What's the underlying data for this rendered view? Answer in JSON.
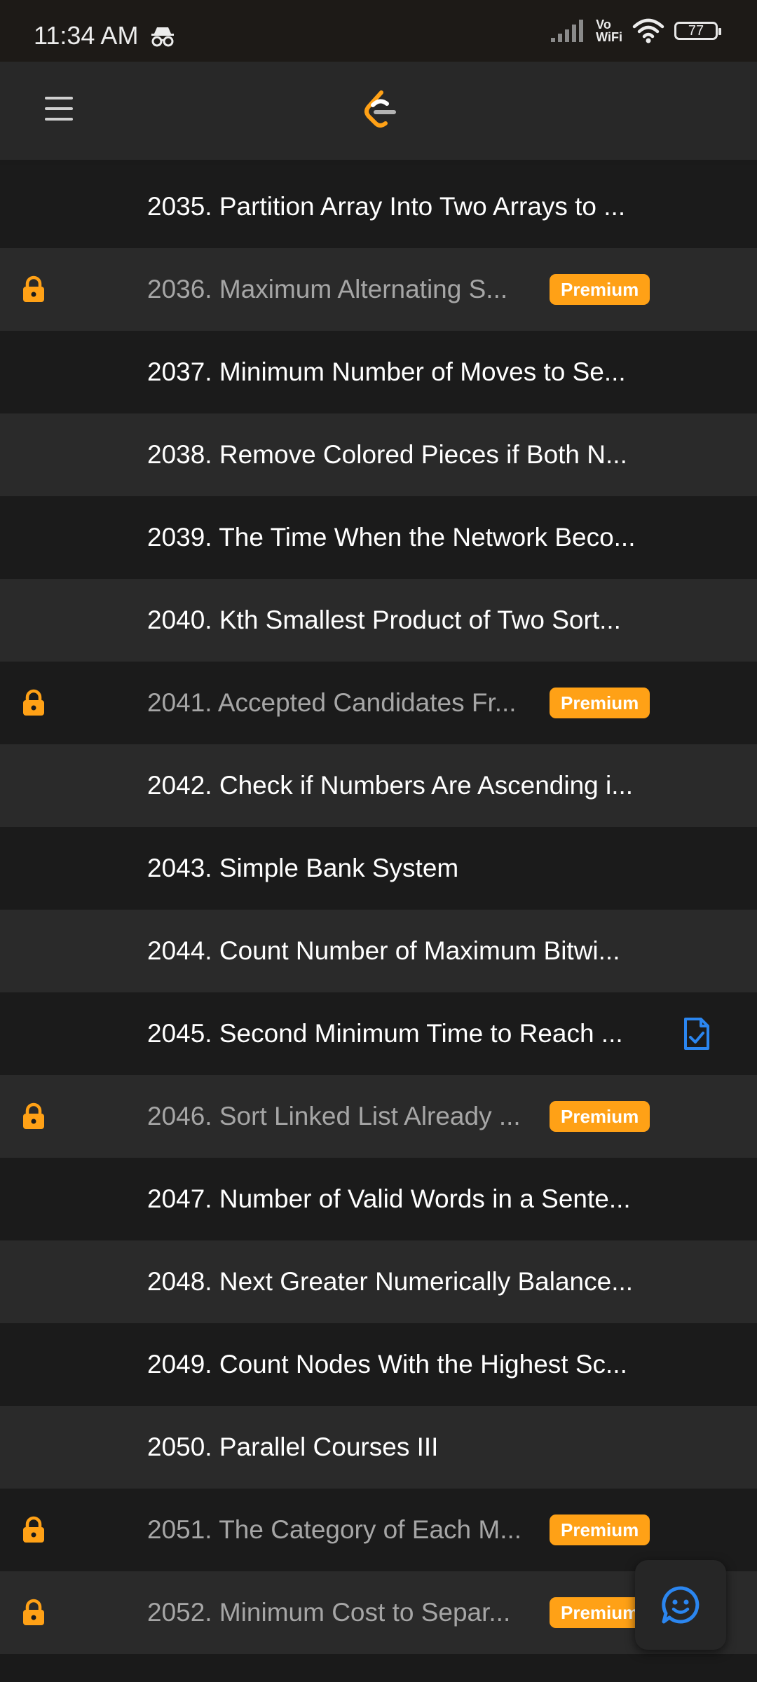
{
  "status_bar": {
    "time": "11:34 AM",
    "vowifi_top": "Vo",
    "vowifi_bottom": "WiFi",
    "battery": "77"
  },
  "header": {
    "menu_icon": "hamburger-menu-icon",
    "logo": "leetcode-logo"
  },
  "colors": {
    "premium": "#ffa116",
    "lock": "#ffa116",
    "solved": "#2b86f0"
  },
  "problems": [
    {
      "title": "2035. Partition Array Into Two Arrays to ...",
      "locked": false,
      "premium_label": "",
      "solved": false
    },
    {
      "title": "2036. Maximum Alternating S...",
      "locked": true,
      "premium_label": "Premium",
      "solved": false
    },
    {
      "title": "2037. Minimum Number of Moves to Se...",
      "locked": false,
      "premium_label": "",
      "solved": false
    },
    {
      "title": "2038. Remove Colored Pieces if Both N...",
      "locked": false,
      "premium_label": "",
      "solved": false
    },
    {
      "title": "2039. The Time When the Network Beco...",
      "locked": false,
      "premium_label": "",
      "solved": false
    },
    {
      "title": "2040. Kth Smallest Product of Two Sort...",
      "locked": false,
      "premium_label": "",
      "solved": false
    },
    {
      "title": "2041. Accepted Candidates Fr...",
      "locked": true,
      "premium_label": "Premium",
      "solved": false
    },
    {
      "title": "2042. Check if Numbers Are Ascending i...",
      "locked": false,
      "premium_label": "",
      "solved": false
    },
    {
      "title": "2043. Simple Bank System",
      "locked": false,
      "premium_label": "",
      "solved": false
    },
    {
      "title": "2044. Count Number of Maximum Bitwi...",
      "locked": false,
      "premium_label": "",
      "solved": false
    },
    {
      "title": "2045. Second Minimum Time to Reach ...",
      "locked": false,
      "premium_label": "",
      "solved": true
    },
    {
      "title": "2046. Sort Linked List Already ...",
      "locked": true,
      "premium_label": "Premium",
      "solved": false
    },
    {
      "title": "2047. Number of Valid Words in a Sente...",
      "locked": false,
      "premium_label": "",
      "solved": false
    },
    {
      "title": "2048. Next Greater Numerically Balance...",
      "locked": false,
      "premium_label": "",
      "solved": false
    },
    {
      "title": "2049. Count Nodes With the Highest Sc...",
      "locked": false,
      "premium_label": "",
      "solved": false
    },
    {
      "title": "2050. Parallel Courses III",
      "locked": false,
      "premium_label": "",
      "solved": false
    },
    {
      "title": "2051. The Category of Each M...",
      "locked": true,
      "premium_label": "Premium",
      "solved": false
    },
    {
      "title": "2052. Minimum Cost to Separ...",
      "locked": true,
      "premium_label": "Premium",
      "solved": false
    }
  ],
  "fab": {
    "icon": "feedback-smiley-icon"
  }
}
